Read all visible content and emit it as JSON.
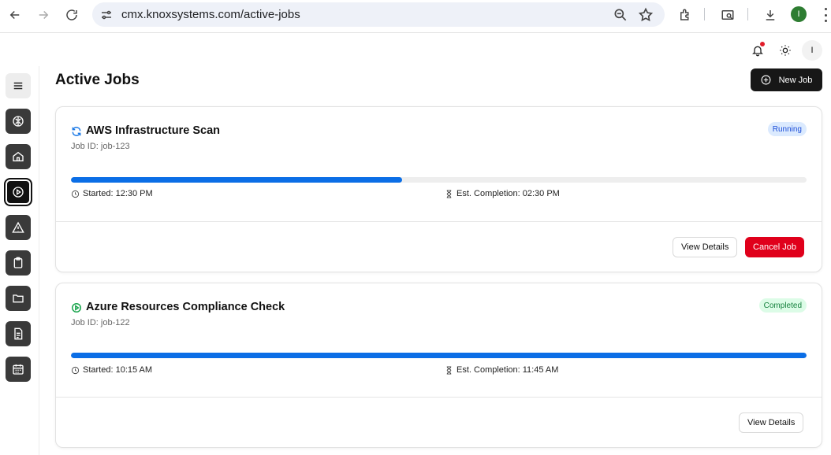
{
  "browser": {
    "url": "cmx.knoxsystems.com/active-jobs",
    "profile_initial": "I"
  },
  "topbar": {
    "user_initial": "I"
  },
  "sidebar": {
    "items": [
      {
        "icon": "brain-icon",
        "name": "ai"
      },
      {
        "icon": "home-icon",
        "name": "home"
      },
      {
        "icon": "play-circle-icon",
        "name": "active-jobs"
      },
      {
        "icon": "warning-icon",
        "name": "alerts"
      },
      {
        "icon": "clipboard-icon",
        "name": "tasks"
      },
      {
        "icon": "folder-icon",
        "name": "files"
      },
      {
        "icon": "document-icon",
        "name": "reports"
      },
      {
        "icon": "calendar-icon",
        "name": "schedule"
      }
    ]
  },
  "main": {
    "title": "Active Jobs",
    "new_job_label": "New Job",
    "jobs": [
      {
        "title": "AWS Infrastructure Scan",
        "job_id": "Job ID: job-123",
        "status": "Running",
        "progress": 0.45,
        "started": "Started: 12:30 PM",
        "est_completion": "Est. Completion: 02:30 PM",
        "view_details_label": "View Details",
        "cancel_label": "Cancel Job"
      },
      {
        "title": "Azure Resources Compliance Check",
        "job_id": "Job ID: job-122",
        "status": "Completed",
        "progress": 1.0,
        "started": "Started: 10:15 AM",
        "est_completion": "Est. Completion: 11:45 AM",
        "view_details_label": "View Details"
      }
    ]
  },
  "colors": {
    "accent": "#0b6ee6",
    "danger": "#e0001b",
    "running_badge_bg": "#dbeafe",
    "completed_badge_bg": "#dcfce7"
  }
}
